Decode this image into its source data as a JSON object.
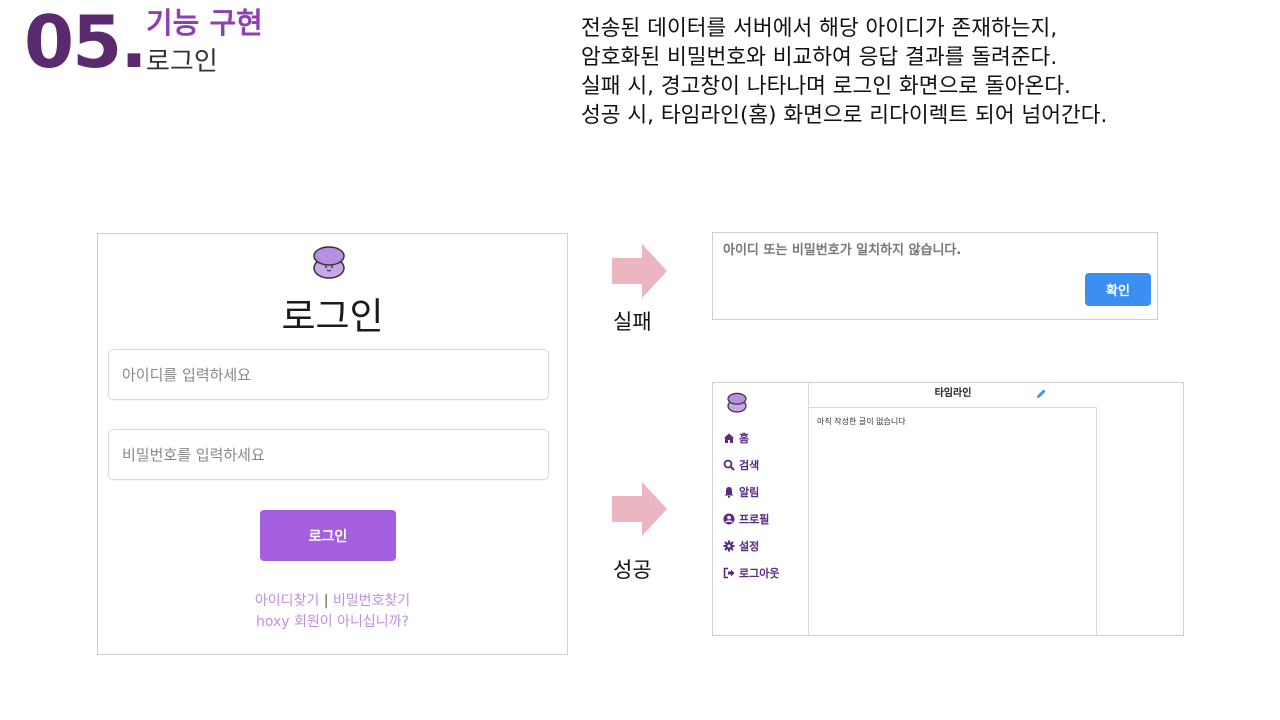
{
  "header": {
    "section_number": "05.",
    "section_title": "기능 구현",
    "section_subtitle": "로그인"
  },
  "description": {
    "lines": [
      "전송된 데이터를 서버에서 해당 아이디가 존재하는지,",
      "암호화된 비밀번호와 비교하여 응답 결과를 돌려준다.",
      "실패 시, 경고창이 나타나며 로그인 화면으로 돌아온다.",
      "성공 시, 타임라인(홈) 화면으로 리다이렉트 되어 넘어간다."
    ]
  },
  "login": {
    "title": "로그인",
    "id_placeholder": "아이디를 입력하세요",
    "pw_placeholder": "비밀번호를 입력하세요",
    "button_label": "로그인",
    "find_id": "아이디찾기",
    "separator": "|",
    "find_pw": "비밀번호찾기",
    "signup_prompt": "hoxy 회원이 아니십니까?"
  },
  "flow": {
    "fail_label": "실패",
    "success_label": "성공"
  },
  "fail_dialog": {
    "message": "아이디 또는 비밀번호가 일치하지 않습니다.",
    "confirm_label": "확인"
  },
  "timeline": {
    "title": "타임라인",
    "empty_message": "아직 작성한 글이 없습니다",
    "nav": [
      {
        "label": "홈",
        "icon": "home-icon"
      },
      {
        "label": "검색",
        "icon": "search-icon"
      },
      {
        "label": "알림",
        "icon": "bell-icon"
      },
      {
        "label": "프로필",
        "icon": "user-icon"
      },
      {
        "label": "설정",
        "icon": "gear-icon"
      },
      {
        "label": "로그아웃",
        "icon": "logout-icon"
      }
    ]
  },
  "colors": {
    "section_number": "#5b2a6e",
    "section_title": "#8e3fb5",
    "login_button": "#a45fde",
    "links": "#c08fe0",
    "confirm_button": "#3b8ef2",
    "arrow": "#ebb6c1",
    "nav_text": "#5a2a86"
  }
}
